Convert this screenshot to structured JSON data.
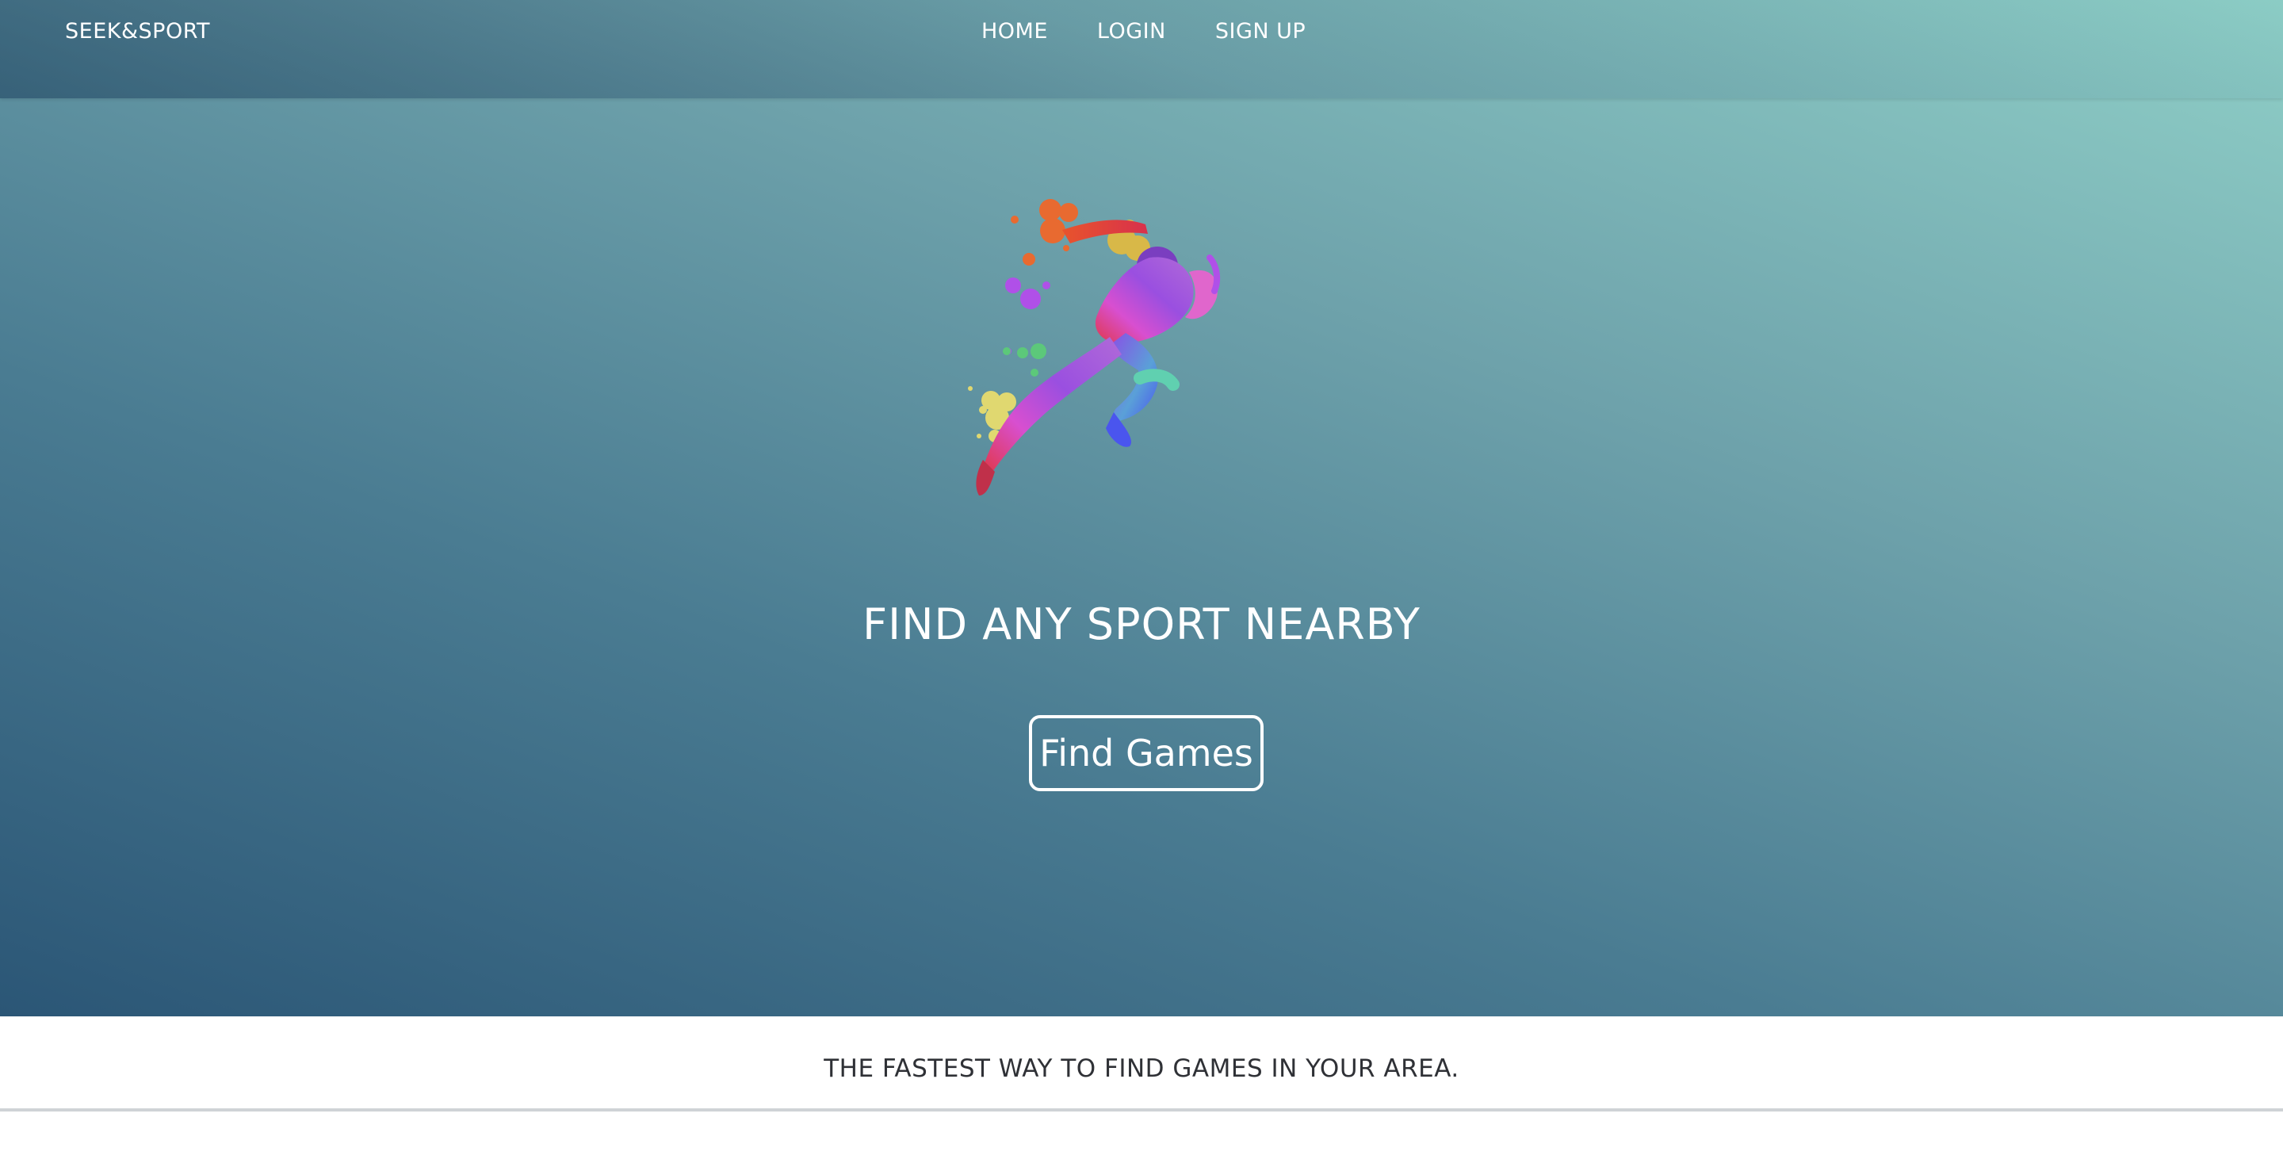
{
  "navbar": {
    "brand": "SEEK&SPORT",
    "links": [
      {
        "label": "HOME"
      },
      {
        "label": "LOGIN"
      },
      {
        "label": "SIGN UP"
      }
    ]
  },
  "hero": {
    "image": {
      "icon": "sprinter-watercolor-illustration"
    },
    "headline": "FIND ANY SPORT NEARBY",
    "cta_label": "Find Games"
  },
  "tagline": "THE FASTEST WAY TO FIND GAMES IN YOUR AREA.",
  "colors": {
    "gradient_dark": "#2b5676",
    "gradient_light": "#8fcfc7",
    "text_light": "#ffffff",
    "text_dark": "#2f3136"
  }
}
